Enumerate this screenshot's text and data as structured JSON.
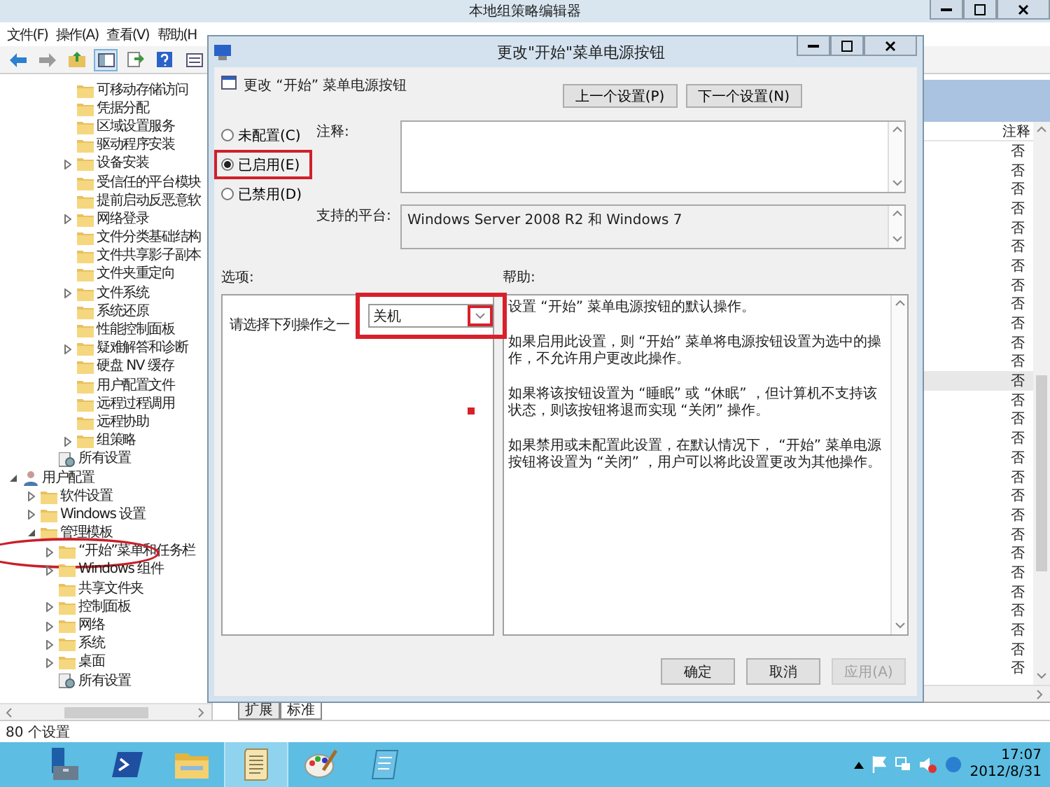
{
  "window": {
    "title": "本地组策略编辑器"
  },
  "menu": [
    "文件(F)",
    "操作(A)",
    "查看(V)",
    "帮助(H"
  ],
  "toolbar": [
    {
      "kind": "back"
    },
    {
      "kind": "forward"
    },
    {
      "kind": "up"
    },
    {
      "kind": "tree",
      "selected": true
    },
    {
      "kind": "export"
    },
    {
      "kind": "help"
    },
    {
      "kind": "view"
    }
  ],
  "tree": [
    {
      "children": [
        {
          "children": [
            {
              "children": [
                {
                  "label": "可移动存储访问",
                  "kind": "folder"
                },
                {
                  "label": "凭据分配",
                  "kind": "folder"
                },
                {
                  "label": "区域设置服务",
                  "kind": "folder"
                },
                {
                  "label": "驱动程序安装",
                  "kind": "folder"
                },
                {
                  "label": "设备安装",
                  "kind": "folder",
                  "expanded": false
                },
                {
                  "label": "受信任的平台模块",
                  "kind": "folder"
                },
                {
                  "label": "提前启动反恶意软",
                  "kind": "folder"
                },
                {
                  "label": "网络登录",
                  "kind": "folder",
                  "expanded": false
                },
                {
                  "label": "文件分类基础结构",
                  "kind": "folder"
                },
                {
                  "label": "文件共享影子副本",
                  "kind": "folder"
                },
                {
                  "label": "文件夹重定向",
                  "kind": "folder"
                },
                {
                  "label": "文件系统",
                  "kind": "folder",
                  "expanded": false
                },
                {
                  "label": "系统还原",
                  "kind": "folder"
                },
                {
                  "label": "性能控制面板",
                  "kind": "folder"
                },
                {
                  "label": "疑难解答和诊断",
                  "kind": "folder",
                  "expanded": false
                },
                {
                  "label": "硬盘 NV 缓存",
                  "kind": "folder"
                },
                {
                  "label": "用户配置文件",
                  "kind": "folder"
                },
                {
                  "label": "远程过程调用",
                  "kind": "folder"
                },
                {
                  "label": "远程协助",
                  "kind": "folder"
                },
                {
                  "label": "组策略",
                  "kind": "folder",
                  "expanded": false
                }
              ]
            },
            {
              "label": "所有设置",
              "kind": "settings"
            }
          ]
        }
      ]
    },
    {
      "label": "用户配置",
      "kind": "user",
      "expanded": true,
      "children": [
        {
          "label": "软件设置",
          "kind": "folder",
          "expanded": false
        },
        {
          "label": "Windows 设置",
          "kind": "folder",
          "expanded": false
        },
        {
          "label": "管理模板",
          "kind": "folder",
          "expanded": true,
          "children": [
            {
              "label": "“开始”菜单和任务栏",
              "kind": "folder",
              "expanded": false,
              "circled": true
            },
            {
              "label": "Windows 组件",
              "kind": "folder",
              "expanded": false
            },
            {
              "label": "共享文件夹",
              "kind": "folder"
            },
            {
              "label": "控制面板",
              "kind": "folder",
              "expanded": false
            },
            {
              "label": "网络",
              "kind": "folder",
              "expanded": false
            },
            {
              "label": "系统",
              "kind": "folder",
              "expanded": false
            },
            {
              "label": "桌面",
              "kind": "folder",
              "expanded": false
            },
            {
              "label": "所有设置",
              "kind": "settings"
            }
          ]
        }
      ]
    }
  ],
  "list": {
    "column": "注释",
    "rows": [
      {
        "value": "否",
        "selected": false
      },
      {
        "value": "否",
        "selected": false
      },
      {
        "value": "否",
        "selected": false
      },
      {
        "value": "否",
        "selected": false
      },
      {
        "value": "否",
        "selected": false
      },
      {
        "value": "否",
        "selected": false
      },
      {
        "value": "否",
        "selected": false
      },
      {
        "value": "否",
        "selected": false
      },
      {
        "value": "否",
        "selected": false
      },
      {
        "value": "否",
        "selected": false
      },
      {
        "value": "否",
        "selected": false
      },
      {
        "value": "否",
        "selected": false
      },
      {
        "value": "否",
        "selected": true
      },
      {
        "value": "否",
        "selected": false
      },
      {
        "value": "否",
        "selected": false
      },
      {
        "value": "否",
        "selected": false
      },
      {
        "value": "否",
        "selected": false
      },
      {
        "value": "否",
        "selected": false
      },
      {
        "value": "否",
        "selected": false
      },
      {
        "value": "否",
        "selected": false
      },
      {
        "value": "否",
        "selected": false
      },
      {
        "value": "否",
        "selected": false
      },
      {
        "value": "否",
        "selected": false
      },
      {
        "value": "否",
        "selected": false
      },
      {
        "value": "否",
        "selected": false
      },
      {
        "value": "否",
        "selected": false
      },
      {
        "value": "否",
        "selected": false
      },
      {
        "value": "否",
        "selected": false
      }
    ]
  },
  "view_tabs": [
    {
      "label": "扩展",
      "selected": false
    },
    {
      "label": "标准",
      "selected": true
    }
  ],
  "status_bar": "80 个设置",
  "dialog": {
    "title": "更改\"开始\"菜单电源按钮",
    "heading": "更改 “开始” 菜单电源按钮",
    "nav_buttons": [
      "上一个设置(P)",
      "下一个设置(N)"
    ],
    "radios": [
      {
        "label": "未配置(C)",
        "selected": false,
        "boxed": false
      },
      {
        "label": "已启用(E)",
        "selected": true,
        "boxed": true
      },
      {
        "label": "已禁用(D)",
        "selected": false,
        "boxed": false
      }
    ],
    "comment_label": "注释:",
    "platform_label": "支持的平台:",
    "platform": "Windows Server 2008 R2 和 Windows 7",
    "options_label": "选项:",
    "help_label": "帮助:",
    "option": {
      "label": "请选择下列操作之一",
      "value": "关机",
      "boxed": true
    },
    "help": [
      "设置 “开始” 菜单电源按钮的默认操作。",
      "如果启用此设置，则 “开始” 菜单将电源按钮设置为选中的操作，不允许用户更改此操作。",
      "如果将该按钮设置为 “睡眠” 或 “休眠” ，但计算机不支持该状态，则该按钮将退而实现 “关闭” 操作。",
      "如果禁用或未配置此设置，在默认情况下， “开始” 菜单电源按钮将设置为 “关闭” ，用户可以将此设置更改为其他操作。"
    ],
    "buttons": [
      {
        "label": "确定",
        "disabled": false
      },
      {
        "label": "取消",
        "disabled": false
      },
      {
        "label": "应用(A)",
        "disabled": true
      }
    ]
  },
  "taskbar": {
    "apps": [
      {
        "kind": "server",
        "active": false
      },
      {
        "kind": "shell",
        "active": false
      },
      {
        "kind": "explorer",
        "active": false
      },
      {
        "kind": "scroll",
        "active": true
      },
      {
        "kind": "paint",
        "active": false
      },
      {
        "kind": "notepad",
        "active": false
      }
    ],
    "tray": [
      {
        "kind": "caret"
      },
      {
        "kind": "flag"
      },
      {
        "kind": "network"
      },
      {
        "kind": "speaker"
      },
      {
        "kind": "language"
      }
    ],
    "time": "17:07",
    "date": "2012/8/31"
  }
}
